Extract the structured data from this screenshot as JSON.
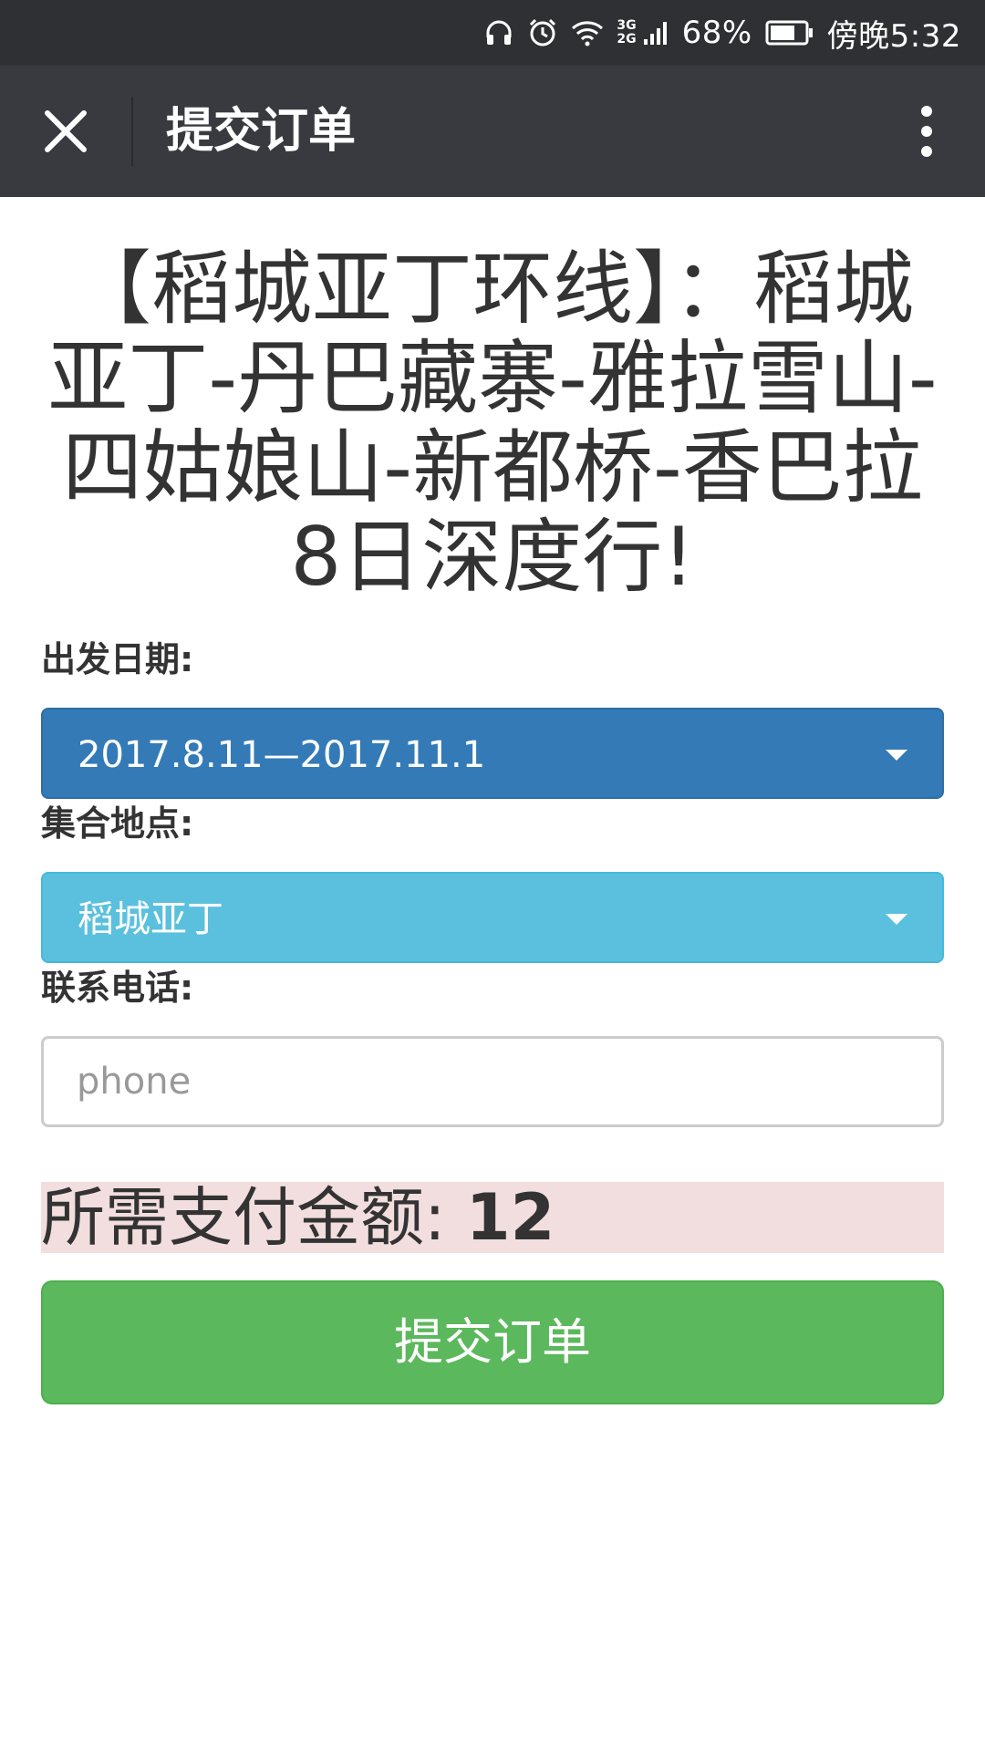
{
  "status_bar": {
    "net_type_top": "3G",
    "net_type_bottom": "2G",
    "battery": "68%",
    "time": "傍晚5:32"
  },
  "app_bar": {
    "title": "提交订单",
    "close_icon": "close-icon",
    "more_icon": "more-vertical-icon"
  },
  "page": {
    "title": "【稻城亚丁环线】：稻城亚丁-丹巴藏寨-雅拉雪山-四姑娘山-新都桥-香巴拉8日深度行!"
  },
  "form": {
    "date_label": "出发日期:",
    "date_value": "2017.8.11—2017.11.1",
    "place_label": "集合地点:",
    "place_value": "稻城亚丁",
    "phone_label": "联系电话:",
    "phone_placeholder": "phone",
    "phone_value": ""
  },
  "payment": {
    "label": "所需支付金额:",
    "amount": "12"
  },
  "submit": {
    "label": "提交订单"
  },
  "colors": {
    "status_bar": "#2f3033",
    "app_bar": "#393a3f",
    "select_date": "#337ab7",
    "select_place": "#5bc0de",
    "amount_bg": "#f2dede",
    "submit": "#5cb85c"
  }
}
